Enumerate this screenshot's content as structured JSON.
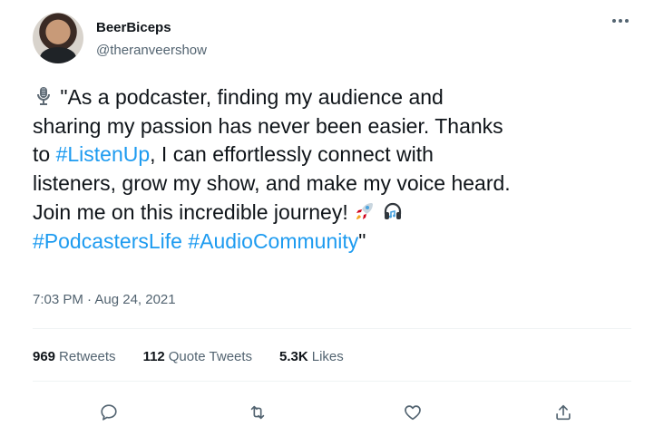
{
  "author": {
    "name": "BeerBiceps",
    "handle": "@theranveershow"
  },
  "tweet": {
    "line1": "\"As a podcaster, finding my audience and",
    "line2": "sharing my passion has never been easier. Thanks",
    "line3_prefix": "to ",
    "line3_hashtag": "#ListenUp",
    "line3_suffix": ", I can effortlessly connect with",
    "line4": "listeners, grow my show, and make my voice heard.",
    "line5": "Join me on this incredible journey!",
    "hashtag2": "#PodcastersLife",
    "hashtag3": "#AudioCommunity",
    "closing_quote": "\"",
    "emojis": [
      "microphone-icon",
      "rocket-icon",
      "headphones-icon"
    ]
  },
  "timestamp": "7:03 PM · Aug 24, 2021",
  "stats": {
    "retweets_count": "969",
    "retweets_label": "Retweets",
    "quote_count": "112",
    "quote_label": "Quote Tweets",
    "likes_count": "5.3K",
    "likes_label": "Likes"
  },
  "colors": {
    "link": "#1d9bf0",
    "secondary_text": "#536471",
    "primary_text": "#0f1419",
    "divider": "#eff3f4"
  }
}
